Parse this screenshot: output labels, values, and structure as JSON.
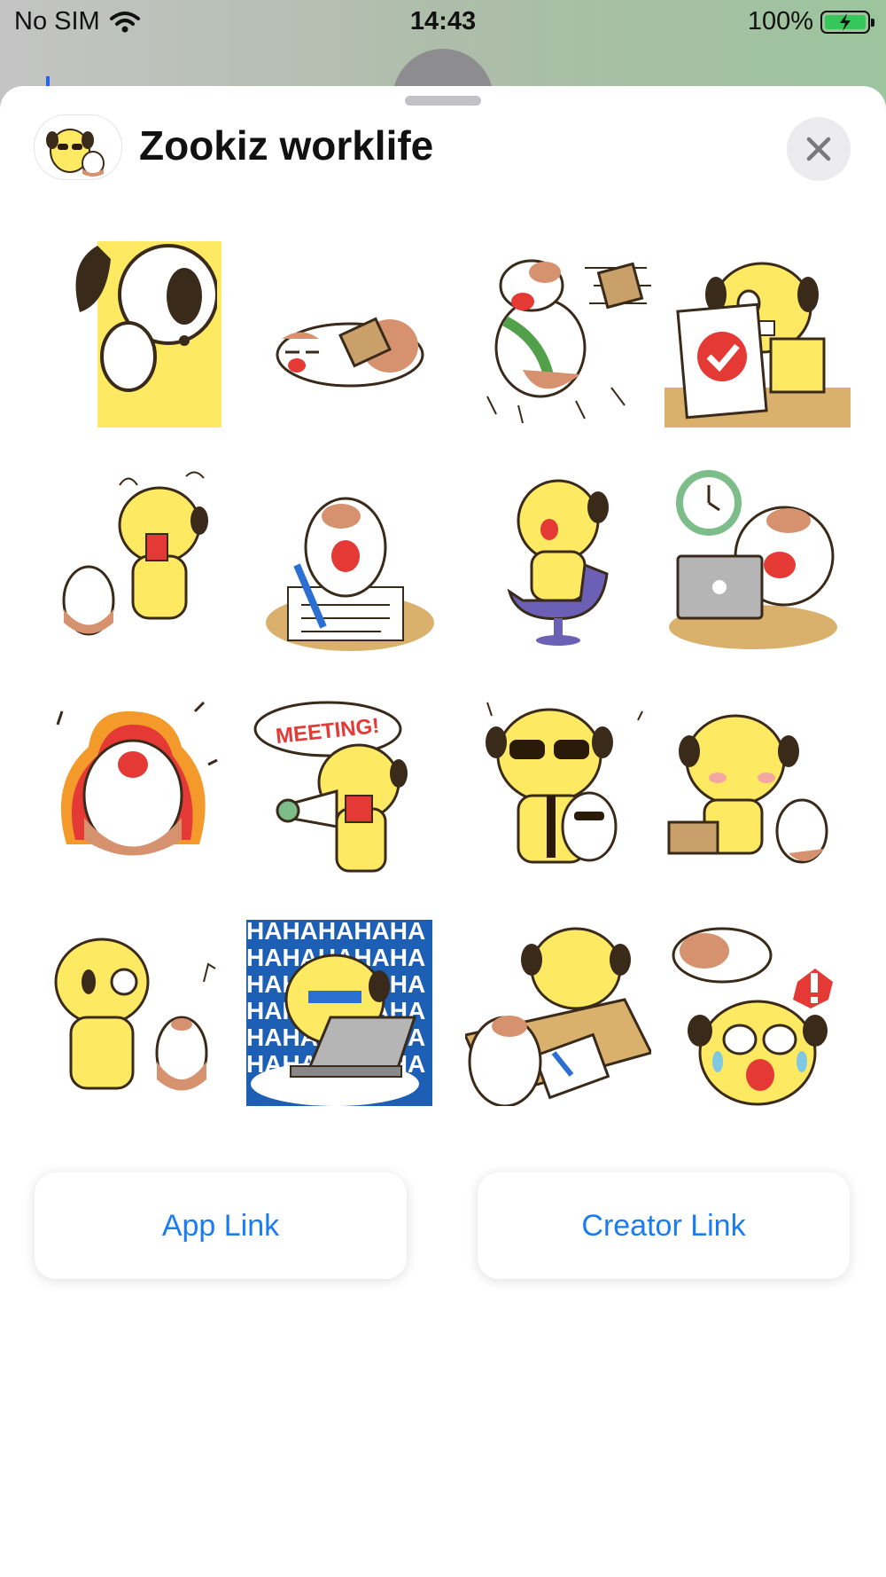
{
  "status_bar": {
    "carrier": "No SIM",
    "time": "14:43",
    "battery": "100%"
  },
  "sheet": {
    "title": "Zookiz worklife"
  },
  "stickers": {
    "meeting_text": "MEETING!",
    "haha_text": "HAHAHAHAHA"
  },
  "buttons": {
    "app_link": "App Link",
    "creator_link": "Creator Link"
  },
  "colors": {
    "accent": "#1a7cf5",
    "character_yellow": "#fde962",
    "hamster_brown": "#d6916e",
    "desk_tan": "#d9b06c"
  }
}
